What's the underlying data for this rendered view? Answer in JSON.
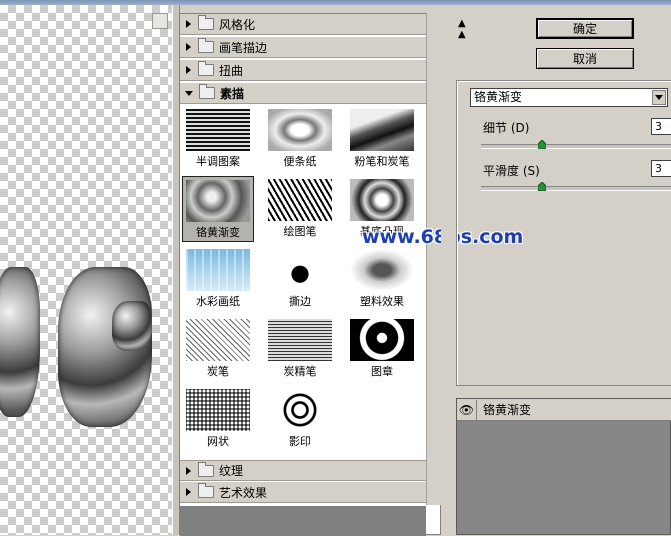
{
  "gallery": {
    "categories_top": [
      {
        "label": "风格化",
        "expanded": false
      },
      {
        "label": "画笔描边",
        "expanded": false
      },
      {
        "label": "扭曲",
        "expanded": false
      },
      {
        "label": "素描",
        "expanded": true
      }
    ],
    "filters": [
      {
        "label": "半调图案",
        "selected": false
      },
      {
        "label": "便条纸",
        "selected": false
      },
      {
        "label": "粉笔和炭笔",
        "selected": false
      },
      {
        "label": "铬黄渐变",
        "selected": true
      },
      {
        "label": "绘图笔",
        "selected": false
      },
      {
        "label": "基底凸现",
        "selected": false
      },
      {
        "label": "水彩画纸",
        "selected": false
      },
      {
        "label": "撕边",
        "selected": false
      },
      {
        "label": "塑料效果",
        "selected": false
      },
      {
        "label": "炭笔",
        "selected": false
      },
      {
        "label": "炭精笔",
        "selected": false
      },
      {
        "label": "图章",
        "selected": false
      },
      {
        "label": "网状",
        "selected": false
      },
      {
        "label": "影印",
        "selected": false
      }
    ],
    "categories_bottom": [
      {
        "label": "纹理",
        "expanded": false
      },
      {
        "label": "艺术效果",
        "expanded": false
      }
    ]
  },
  "watermark": "www.68ps.com",
  "buttons": {
    "ok": "确定",
    "cancel": "取消"
  },
  "params": {
    "filter_select": "铬黄渐变",
    "detail": {
      "label": "细节 (D)",
      "value": "3",
      "level": 0.3
    },
    "smoothness": {
      "label": "平滑度 (S)",
      "value": "3",
      "level": 0.3
    }
  },
  "layers": {
    "item": "铬黄渐变"
  },
  "colors": {
    "accent": "#1f3fb0",
    "panel": "#d4d0c8",
    "selected": "#b4b2ac"
  }
}
